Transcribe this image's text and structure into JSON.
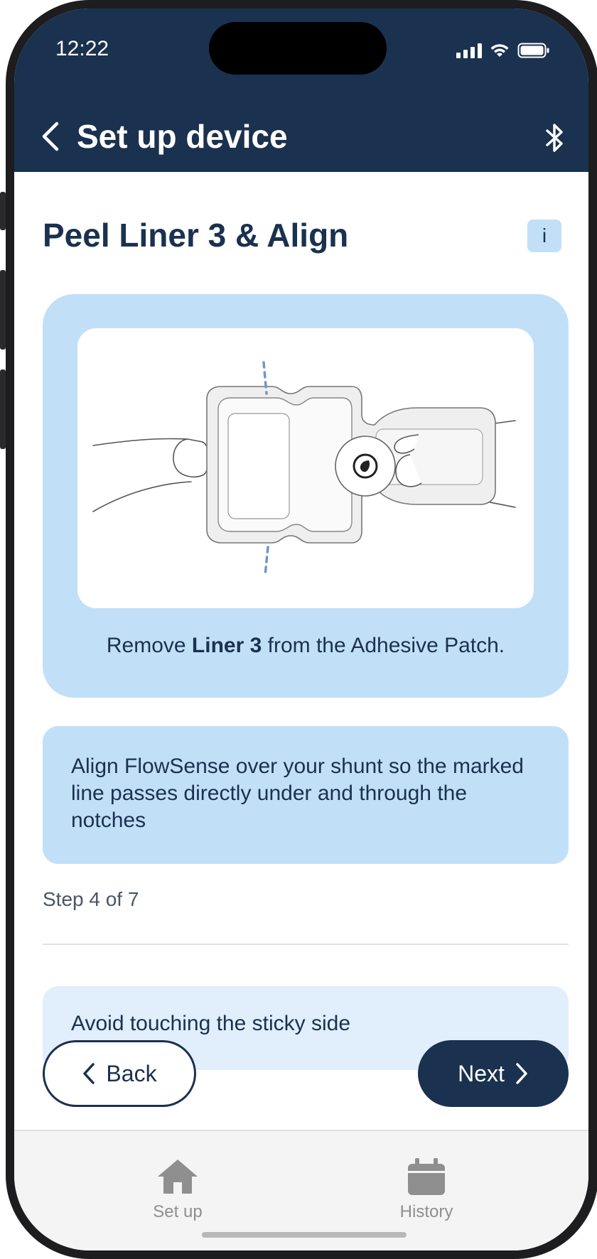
{
  "status_bar": {
    "time": "12:22"
  },
  "app_bar": {
    "title": "Set up device",
    "back_icon": "chevron-left-icon",
    "bluetooth_icon": "bluetooth-icon"
  },
  "page": {
    "heading": "Peel Liner 3 & Align",
    "info_label": "i"
  },
  "illustration_card": {
    "caption_before": "Remove ",
    "caption_bold": "Liner 3",
    "caption_after": " from the Adhesive Patch."
  },
  "instruction": "Align FlowSense over your shunt so the marked line passes directly under and through the notches",
  "progress": {
    "label": "Step 4 of 7",
    "current": 4,
    "total": 7
  },
  "tip": "Avoid touching the sticky side",
  "buttons": {
    "back": "Back",
    "next": "Next"
  },
  "tab_bar": {
    "items": [
      {
        "label": "Set up",
        "icon": "home-icon"
      },
      {
        "label": "History",
        "icon": "calendar-icon"
      }
    ]
  },
  "colors": {
    "brand_navy": "#1a314f",
    "card_blue": "#c2dff8",
    "tip_blue": "#e1eefb",
    "tab_gray": "#8f8f8f"
  }
}
